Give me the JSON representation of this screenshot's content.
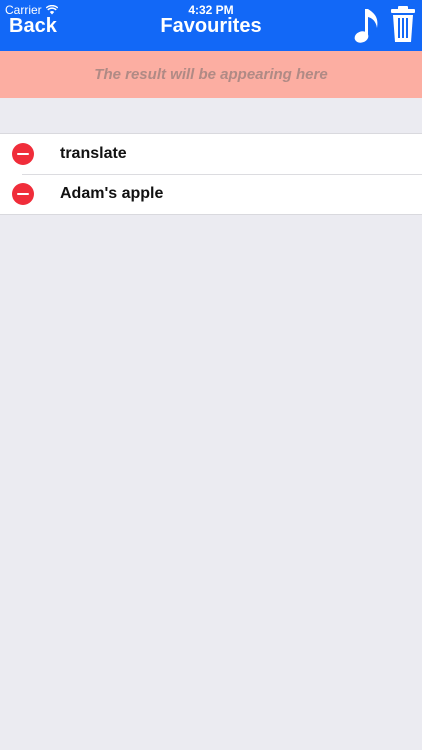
{
  "status_bar": {
    "carrier": "Carrier",
    "time": "4:32 PM"
  },
  "nav": {
    "back_label": "Back",
    "title": "Favourites",
    "music_icon": "music-note-icon",
    "trash_icon": "trash-icon"
  },
  "result_banner": {
    "text": "The result will be appearing here"
  },
  "favourites": {
    "items": [
      {
        "label": "translate"
      },
      {
        "label": "Adam's apple"
      }
    ]
  },
  "colors": {
    "nav_background": "#1268f7",
    "banner_background": "#fcaea2",
    "delete_red": "#f02d3a",
    "page_background": "#ebebf1"
  }
}
